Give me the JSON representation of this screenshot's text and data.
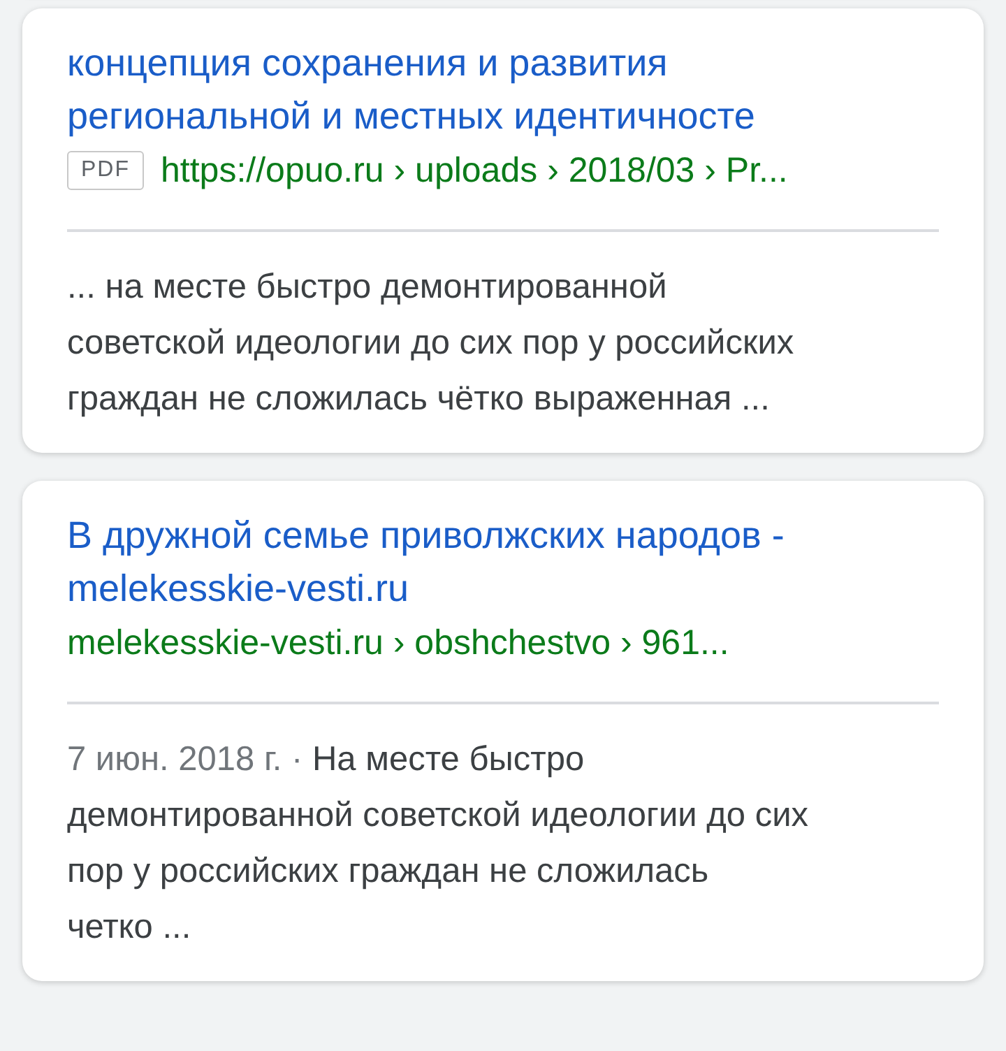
{
  "results": [
    {
      "title_lines": [
        "концепция сохранения и развития",
        "региональной и местных идентичносте"
      ],
      "badge": "PDF",
      "url": "https://opuo.ru › uploads › 2018/03 › Pr...",
      "snippet_lines": [
        "... на месте быстро демонтированной",
        "советской идеологии до сих пор у российских",
        "граждан не сложилась чётко выраженная ..."
      ]
    },
    {
      "title_lines": [
        "В дружной семье приволжских народов -",
        "melekesskie-vesti.ru"
      ],
      "url": "melekesskie-vesti.ru › obshchestvo › 961...",
      "date": "7 июн. 2018 г. ·",
      "snippet_lines": [
        "На месте быстро",
        "демонтированной советской идеологии до сих",
        "пор у российских граждан не сложилась",
        "четко ..."
      ]
    }
  ]
}
